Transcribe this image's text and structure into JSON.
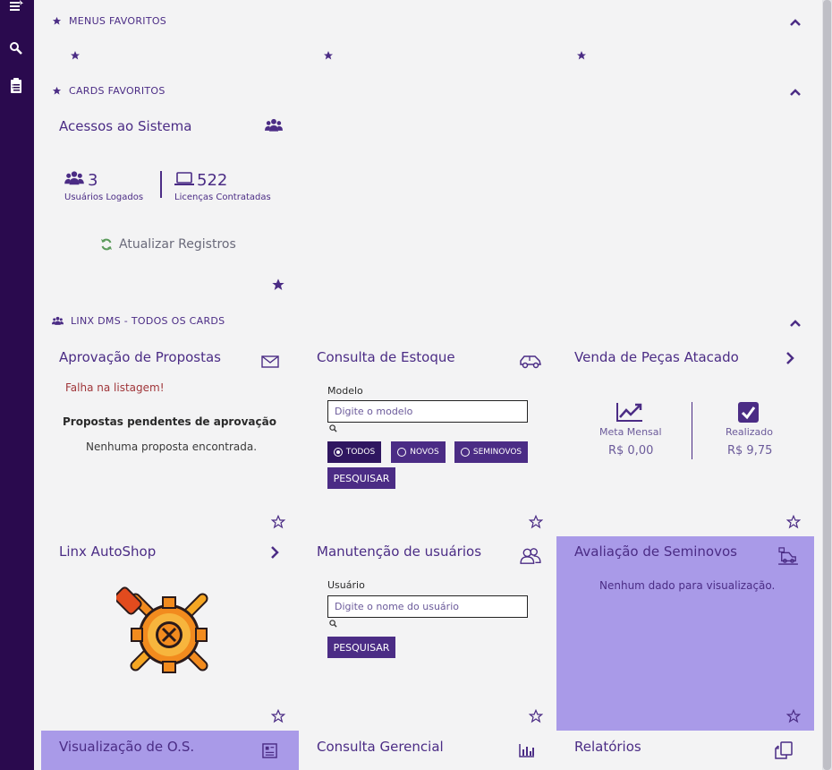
{
  "sidebar": {
    "icons": [
      "menu-icon",
      "search-icon",
      "clipboard-icon"
    ]
  },
  "sections": {
    "menus_favoritos": {
      "title": "MENUS FAVORITOS"
    },
    "cards_favoritos": {
      "title": "CARDS FAVORITOS"
    },
    "todos_cards": {
      "title": "LINX DMS - TODOS OS CARDS"
    }
  },
  "acessos": {
    "title": "Acessos ao Sistema",
    "logged_value": "3",
    "logged_label": "Usuários Logados",
    "licenses_value": "522",
    "licenses_label": "Licenças Contratadas",
    "refresh_label": "Atualizar Registros"
  },
  "aprovacao": {
    "title": "Aprovação de Propostas",
    "error": "Falha na listagem!",
    "subtitle": "Propostas pendentes de aprovação",
    "empty": "Nenhuma proposta encontrada."
  },
  "estoque": {
    "title": "Consulta de Estoque",
    "model_label": "Modelo",
    "model_placeholder": "Digite o modelo",
    "filters": [
      "TODOS",
      "NOVOS",
      "SEMINOVOS"
    ],
    "selected_filter": "TODOS",
    "search_button": "PESQUISAR"
  },
  "pecas": {
    "title": "Venda de Peças Atacado",
    "meta_label": "Meta Mensal",
    "meta_value": "R$ 0,00",
    "realizado_label": "Realizado",
    "realizado_value": "R$ 9,75"
  },
  "autoshop": {
    "title": "Linx AutoShop"
  },
  "manutencao": {
    "title": "Manutenção de usuários",
    "user_label": "Usuário",
    "user_placeholder": "Digite o nome do usuário",
    "search_button": "PESQUISAR"
  },
  "seminovos": {
    "title": "Avaliação de Seminovos",
    "empty": "Nenhum dado para visualização."
  },
  "visualizacao_os": {
    "title": "Visualização de O.S."
  },
  "consulta_gerencial": {
    "title": "Consulta Gerencial"
  },
  "relatorios": {
    "title": "Relatórios"
  },
  "colors": {
    "primary": "#4b2c85",
    "sidebar": "#2a0a4e",
    "highlight": "#a99ae8",
    "error": "#a0363a"
  }
}
